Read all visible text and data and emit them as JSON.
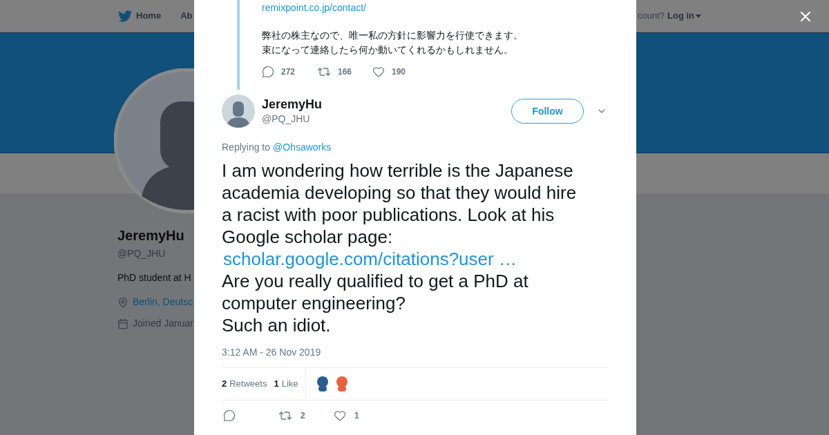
{
  "nav": {
    "items": [
      {
        "label": "Home",
        "kind": "home"
      },
      {
        "label": "Ab",
        "kind": "plain"
      }
    ],
    "login_prompt": "count?",
    "login": "Log in"
  },
  "profile": {
    "name": "JeremyHu",
    "handle": "@PQ_JHU",
    "bio": "PhD student at H",
    "location": "Berlin, Deutsc",
    "joined": "Joined Januar"
  },
  "parent_tweet": {
    "link": "remixpoint.co.jp/contact/",
    "lines": [
      "弊社の株主なので、唯一私の方針に影響力を行使できます。",
      "束になって連絡したら何か動いてくれるかもしれません。"
    ],
    "actions": [
      {
        "kind": "reply",
        "count": "272"
      },
      {
        "kind": "retweet",
        "count": "166"
      },
      {
        "kind": "like",
        "count": "190"
      }
    ]
  },
  "tweet": {
    "name": "JeremyHu",
    "handle": "@PQ_JHU",
    "follow": "Follow",
    "replying_label": "Replying to",
    "replying_to": "@Ohsaworks",
    "body": [
      {
        "kind": "text",
        "text": "I am wondering how terrible is the Japanese academia developing so that they would hire a racist with poor publications. Look at his Google scholar page:"
      },
      {
        "kind": "link",
        "text": "scholar.google.com/citations?user …"
      },
      {
        "kind": "text",
        "text": "Are you really qualified to get a PhD at computer engineering?"
      },
      {
        "kind": "text",
        "text": "Such an idiot."
      }
    ],
    "time": "3:12 AM - 26 Nov 2019",
    "stats": [
      {
        "count": "2",
        "label": "Retweets"
      },
      {
        "count": "1",
        "label": "Like"
      }
    ],
    "likers": [
      {
        "color": "#2a5d8f"
      },
      {
        "color": "#e8603c"
      }
    ],
    "actions": [
      {
        "kind": "reply"
      },
      {
        "kind": "retweet",
        "count": "2"
      },
      {
        "kind": "like",
        "count": "1"
      }
    ]
  }
}
